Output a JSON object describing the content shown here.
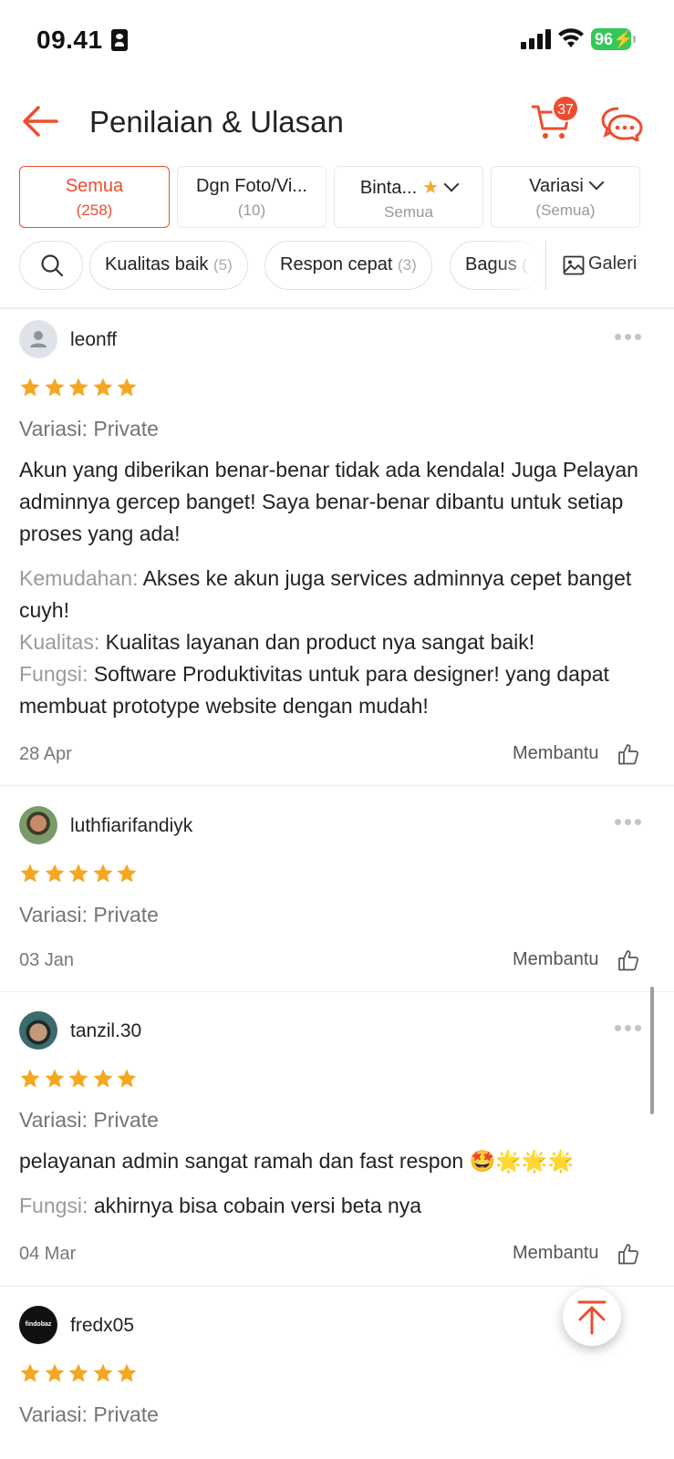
{
  "status_bar": {
    "time": "09.41",
    "battery": "96"
  },
  "header": {
    "title": "Penilaian & Ulasan",
    "cart_count": "37"
  },
  "tabs": [
    {
      "label": "Semua",
      "sub": "(258)"
    },
    {
      "label": "Dgn Foto/Vi...",
      "sub": "(10)"
    },
    {
      "label": "Binta...",
      "sub": "Semua"
    },
    {
      "label": "Variasi",
      "sub": "(Semua)"
    }
  ],
  "chips": [
    {
      "label": "Kualitas baik",
      "count": "(5)"
    },
    {
      "label": "Respon cepat",
      "count": "(3)"
    },
    {
      "label": "Bagus",
      "count": "("
    }
  ],
  "gallery_label": "Galeri",
  "helpful_label": "Membantu",
  "reviews": [
    {
      "username": "leonff",
      "rating": 5,
      "variation": "Variasi: Private",
      "text": "Akun yang diberikan benar-benar tidak ada kendala! Juga Pelayan adminnya gercep banget! Saya benar-benar dibantu untuk setiap proses yang ada!",
      "attributes": [
        {
          "key": "Kemudahan:",
          "value": "Akses ke akun juga services adminnya cepet banget cuyh!"
        },
        {
          "key": "Kualitas:",
          "value": "Kualitas layanan dan product nya sangat baik!"
        },
        {
          "key": "Fungsi:",
          "value": "Software Produktivitas untuk para designer! yang dapat membuat prototype website dengan mudah!"
        }
      ],
      "date": "28 Apr"
    },
    {
      "username": "luthfiarifandiyk",
      "rating": 5,
      "variation": "Variasi: Private",
      "date": "03 Jan"
    },
    {
      "username": "tanzil.30",
      "rating": 5,
      "variation": "Variasi: Private",
      "text": "pelayanan admin sangat ramah dan fast respon 🤩🌟🌟🌟",
      "attributes": [
        {
          "key": "Fungsi:",
          "value": "akhirnya bisa cobain versi beta nya"
        }
      ],
      "date": "04 Mar"
    },
    {
      "username": "fredx05",
      "avatar_text": "findobaz",
      "rating": 5,
      "variation": "Variasi: Private"
    }
  ],
  "colors": {
    "accent": "#ee4d2d",
    "star": "#f5a623"
  }
}
